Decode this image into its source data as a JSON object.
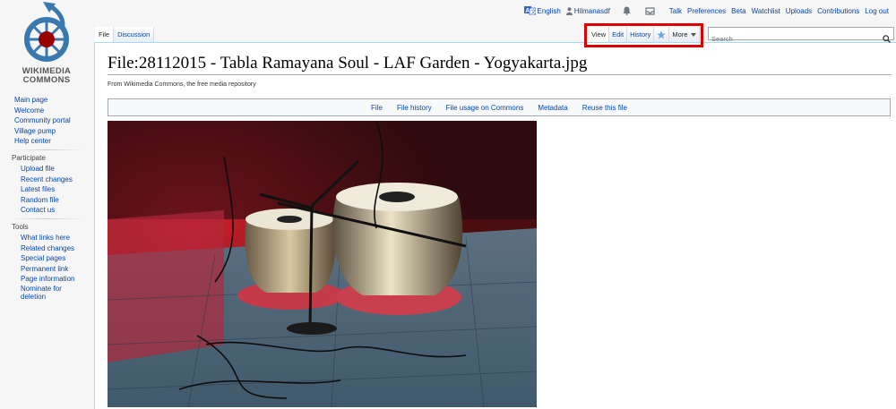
{
  "logo": {
    "line1": "WIKIMEDIA",
    "line2": "COMMONS"
  },
  "sidebar": {
    "main": [
      "Main page",
      "Welcome",
      "Community portal",
      "Village pump",
      "Help center"
    ],
    "participate": {
      "heading": "Participate",
      "items": [
        "Upload file",
        "Recent changes",
        "Latest files",
        "Random file",
        "Contact us"
      ]
    },
    "tools": {
      "heading": "Tools",
      "items": [
        "What links here",
        "Related changes",
        "Special pages",
        "Permanent link",
        "Page information",
        "Nominate for deletion"
      ]
    }
  },
  "personal": {
    "language": "English",
    "username": "Hilmanasdf",
    "links": [
      "Talk",
      "Preferences",
      "Beta",
      "Watchlist",
      "Uploads",
      "Contributions",
      "Log out"
    ]
  },
  "tabs": {
    "left": [
      "File",
      "Discussion"
    ],
    "right": {
      "view": "View",
      "edit": "Edit",
      "history": "History",
      "more": "More"
    }
  },
  "search": {
    "placeholder": "Search"
  },
  "page": {
    "title": "File:28112015 - Tabla Ramayana Soul - LAF Garden - Yogyakarta.jpg",
    "tagline": "From Wikimedia Commons, the free media repository"
  },
  "filetoc": [
    "File",
    "File history",
    "File usage on Commons",
    "Metadata",
    "Reuse this file"
  ],
  "colors": {
    "link": "#0645ad",
    "highlight": "#dd0000",
    "logo_blue": "#3a78b0",
    "logo_red": "#990000"
  }
}
